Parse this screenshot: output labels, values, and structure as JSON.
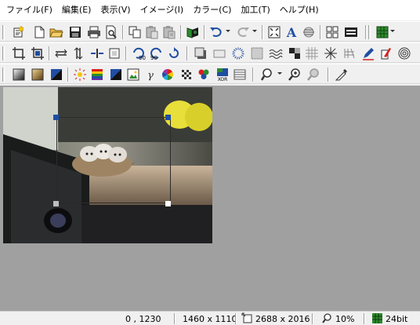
{
  "menu": [
    "ファイル(F)",
    "編集(E)",
    "表示(V)",
    "イメージ(I)",
    "カラー(C)",
    "加工(T)",
    "ヘルプ(H)"
  ],
  "toolbar1": [
    "new-document-icon",
    "blank-page-icon",
    "open-folder-icon",
    "save-icon",
    "print-icon",
    "print-preview-icon",
    "copy-icon",
    "paste-icon",
    "paste-special-icon",
    "capture-icon",
    "undo-icon",
    "redo-icon",
    "fit-window-icon",
    "text-icon",
    "deskew-icon",
    "grid-view-icon",
    "filmstrip-icon",
    "thumbnail-grid-icon"
  ],
  "toolbar2": [
    "crop-icon",
    "autocrop-icon",
    "flip-horizontal-icon",
    "flip-vertical-icon",
    "resize-icon",
    "canvas-icon",
    "rotate-left-90-icon",
    "rotate-right-90-icon",
    "rotate-free-icon",
    "shadow-icon",
    "emboss-icon",
    "blur-icon",
    "noise-icon",
    "wave-icon",
    "posterize-icon",
    "mosaic-icon",
    "sharpen-icon",
    "texture-icon",
    "pencil-icon",
    "marker-icon",
    "spiral-icon"
  ],
  "toolbar3": [
    "grayscale-icon",
    "sepia-icon",
    "negative-icon",
    "brightness-icon",
    "color-balance-icon",
    "contrast-icon",
    "hue-saturation-icon",
    "gamma-icon",
    "rgb-adjust-icon",
    "dither-icon",
    "channel-icon",
    "xor-icon",
    "palette-icon",
    "zoom-menu-icon",
    "zoom-in-icon",
    "zoom-out-icon",
    "eyedropper-icon"
  ],
  "status": {
    "cursor": "0 , 1230",
    "selection": "1460 x 1110",
    "image_size": "2688 x 2016",
    "zoom": "10%",
    "bit_depth": "24bit"
  },
  "colors": {
    "workspace": "#a0a0a0",
    "handle": "#1f4ea3",
    "accent_blue": "#1f4ea3",
    "accent_red": "#d81e1e",
    "accent_green": "#2e8b2e",
    "accent_yellow": "#f4c400"
  }
}
